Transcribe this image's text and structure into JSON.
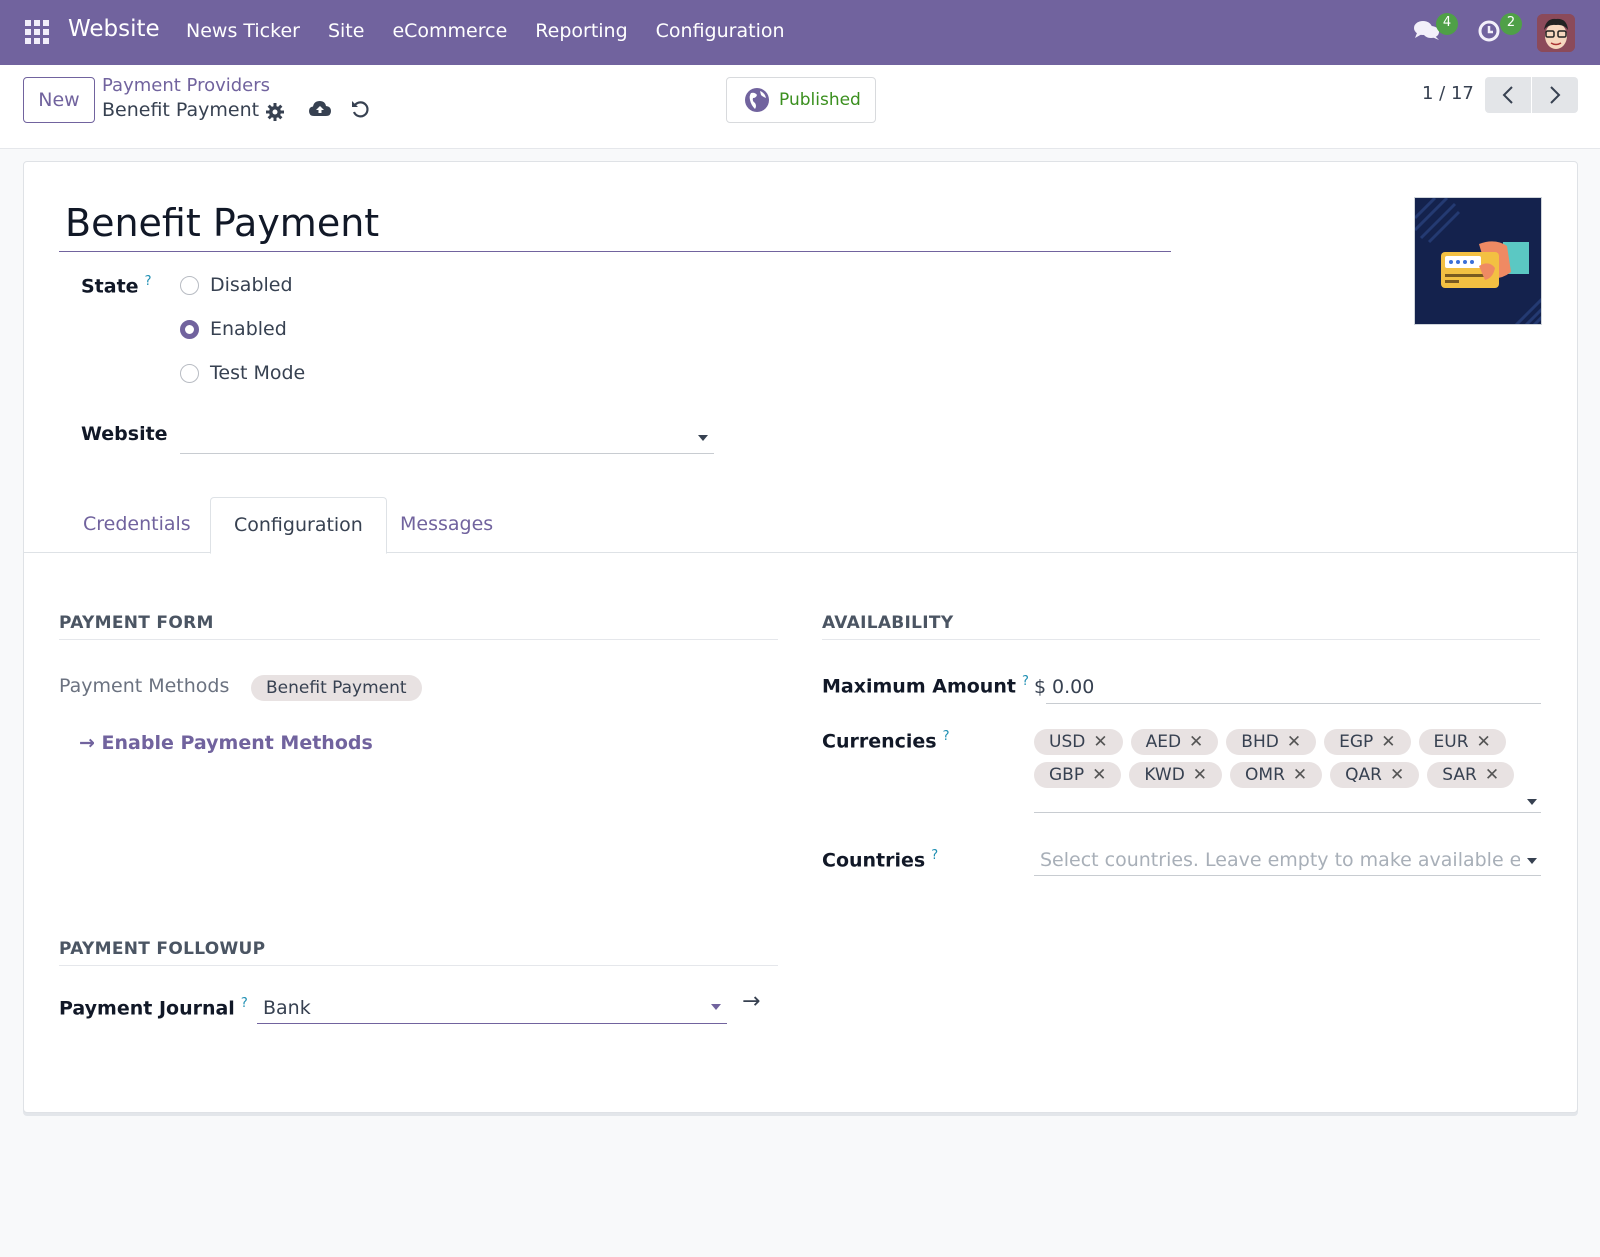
{
  "navbar": {
    "app_name": "Website",
    "menu": [
      "News Ticker",
      "Site",
      "eCommerce",
      "Reporting",
      "Configuration"
    ],
    "messages_count": "4",
    "activities_count": "2",
    "color": "#71639e"
  },
  "control_panel": {
    "new_label": "New",
    "breadcrumb_parent": "Payment Providers",
    "breadcrumb_current": "Benefit Payment",
    "published_label": "Published",
    "pager": "1 / 17"
  },
  "form": {
    "title": "Benefit Payment",
    "state_label": "State",
    "help_mark": "?",
    "state_options": [
      {
        "label": "Disabled",
        "checked": false
      },
      {
        "label": "Enabled",
        "checked": true
      },
      {
        "label": "Test Mode",
        "checked": false
      }
    ],
    "website_label": "Website",
    "website_value": ""
  },
  "tabs": [
    {
      "label": "Credentials",
      "active": false
    },
    {
      "label": "Configuration",
      "active": true
    },
    {
      "label": "Messages",
      "active": false
    }
  ],
  "payment_form": {
    "section_title": "PAYMENT FORM",
    "methods_label": "Payment Methods",
    "methods": [
      "Benefit Payment"
    ],
    "enable_link": "Enable Payment Methods"
  },
  "availability": {
    "section_title": "AVAILABILITY",
    "max_amount_label": "Maximum Amount",
    "currency_symbol": "$",
    "max_amount_value": "0.00",
    "currencies_label": "Currencies",
    "currencies": [
      "USD",
      "AED",
      "BHD",
      "EGP",
      "EUR",
      "GBP",
      "KWD",
      "OMR",
      "QAR",
      "SAR"
    ],
    "countries_label": "Countries",
    "countries_placeholder": "Select countries. Leave empty to make available everywhere."
  },
  "payment_followup": {
    "section_title": "PAYMENT FOLLOWUP",
    "journal_label": "Payment Journal",
    "journal_value": "Bank"
  }
}
